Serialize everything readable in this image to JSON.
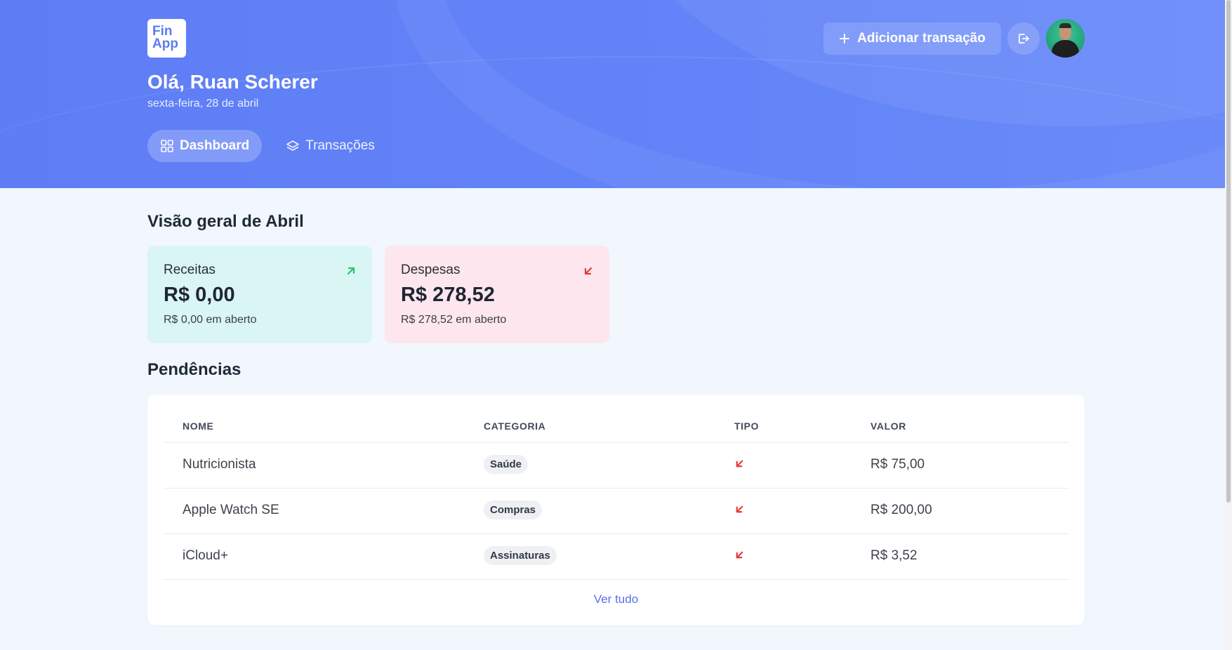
{
  "header": {
    "logo_line1": "Fin",
    "logo_line2": "App",
    "greeting": "Olá, Ruan Scherer",
    "date": "sexta-feira, 28 de abril",
    "add_transaction_label": "Adicionar transação",
    "tabs": [
      {
        "label": "Dashboard",
        "active": true,
        "icon": "grid-icon"
      },
      {
        "label": "Transações",
        "active": false,
        "icon": "layers-icon"
      }
    ]
  },
  "overview": {
    "title": "Visão geral de Abril",
    "income": {
      "label": "Receitas",
      "amount": "R$ 0,00",
      "open": "R$ 0,00 em aberto",
      "color": "#d9f5f4",
      "arrow_color": "#2fbf71"
    },
    "expense": {
      "label": "Despesas",
      "amount": "R$ 278,52",
      "open": "R$ 278,52 em aberto",
      "color": "#fde6ee",
      "arrow_color": "#e23a3a"
    }
  },
  "pending": {
    "title": "Pendências",
    "columns": [
      "NOME",
      "CATEGORIA",
      "TIPO",
      "VALOR"
    ],
    "rows": [
      {
        "name": "Nutricionista",
        "category": "Saúde",
        "type": "expense",
        "value": "R$ 75,00"
      },
      {
        "name": "Apple Watch SE",
        "category": "Compras",
        "type": "expense",
        "value": "R$ 200,00"
      },
      {
        "name": "iCloud+",
        "category": "Assinaturas",
        "type": "expense",
        "value": "R$ 3,52"
      }
    ],
    "see_all": "Ver tudo"
  },
  "colors": {
    "accent": "#5f7df5",
    "background": "#f1f7fc",
    "expense_red": "#e23a3a",
    "income_green": "#2fbf71"
  }
}
